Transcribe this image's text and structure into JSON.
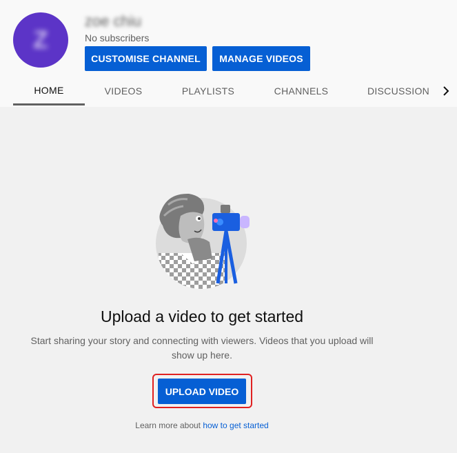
{
  "channel": {
    "avatar_letter": "Z",
    "name": "zoe chiu",
    "subscribers": "No subscribers",
    "avatar_color": "#5c34c7"
  },
  "actions": {
    "customise_label": "CUSTOMISE CHANNEL",
    "manage_label": "MANAGE VIDEOS"
  },
  "tabs": [
    {
      "label": "HOME",
      "active": true
    },
    {
      "label": "VIDEOS",
      "active": false
    },
    {
      "label": "PLAYLISTS",
      "active": false
    },
    {
      "label": "CHANNELS",
      "active": false
    },
    {
      "label": "DISCUSSION",
      "active": false
    }
  ],
  "tabs_next_icon": "chevron-right-icon",
  "empty_state": {
    "illustration_icon": "videographer-illustration",
    "headline": "Upload a video to get started",
    "description": "Start sharing your story and connecting with viewers. Videos that you upload will show up here.",
    "upload_label": "UPLOAD VIDEO",
    "learn_prefix": "Learn more about ",
    "learn_link": "how to get started"
  },
  "colors": {
    "accent": "#065fd4",
    "highlight_border": "#e02020",
    "page_bg": "#f1f1f1",
    "header_bg": "#f9f9f9"
  }
}
